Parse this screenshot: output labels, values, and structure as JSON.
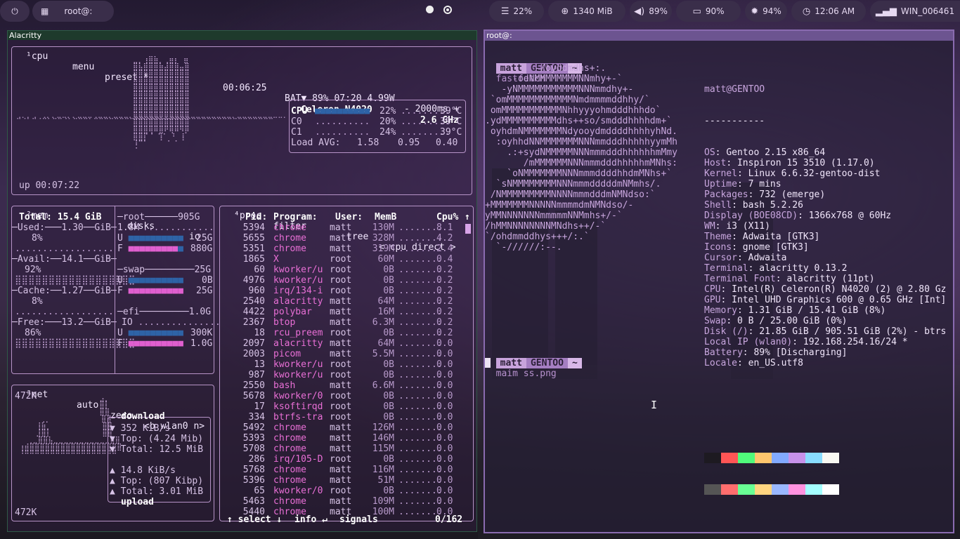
{
  "topbar": {
    "power_icon": "power-icon",
    "apps_icon": "grid-icon",
    "window_title": "root@:",
    "cpu": "22%",
    "ram": "1340 MiB",
    "volume": "89%",
    "battery": "90%",
    "brightness": "94%",
    "time": "12:06 AM",
    "network": "WIN_006461"
  },
  "left_window": {
    "title": "Alacritty",
    "cpu_box": {
      "header_num": "¹cpu",
      "menu": "menu",
      "preset": "preset *",
      "clock": "00:06:25",
      "bat": "BAT▼ 89% 07:20 4.99W",
      "interval": "- 2000ms +",
      "uptime": "up 00:07:22",
      "cpu_name": "Celeron N4020",
      "cpu_freq": "2.6 GHz",
      "rows": [
        {
          "label": "CPU",
          "bar": "■■■■■■■■■■",
          "pct": "22%",
          "temp": "39°C"
        },
        {
          "label": "C0",
          "bar": "..........",
          "pct": "20%",
          "temp": "39°C"
        },
        {
          "label": "C1",
          "bar": "..........",
          "pct": "24%",
          "temp": "39°C"
        }
      ],
      "load_label": "Load AVG:",
      "load": [
        "1.58",
        "0.95",
        "0.40"
      ]
    },
    "mem_box": {
      "header": "²mem",
      "total": "Total: 15.4 GiB",
      "used": "─Used:───1.30──GiB─",
      "used_pct": "8%",
      "avail": "─Avail:──14.1──GiB─",
      "avail_pct": "92%",
      "cache": "─Cache:──1.27──GiB─",
      "cache_pct": "8%",
      "free": "─Free:───13.2──GiB─",
      "free_pct": "86%"
    },
    "disks_box": {
      "header": "disks",
      "io": "io",
      "root_name": "root",
      "root_size": "905G",
      "root_io": "1.8M",
      "root_u": "25G",
      "root_f": "880G",
      "swap_name": "swap",
      "swap_size": "25G",
      "swap_u": "0B",
      "swap_f": "25G",
      "efi_name": "efi",
      "efi_size": "1.0G",
      "efi_io": "IO",
      "efi_u": "300K",
      "efi_f": "1.0G"
    },
    "net_box": {
      "header": "³net",
      "auto": "auto",
      "zero": "zero",
      "iface": "<b wlan0 n>",
      "top_scale": "472K",
      "bottom_scale": "472K",
      "download": "download",
      "dl_rate": "▼ 352 KiB/s",
      "dl_top": "▼ Top: (4.24 Mib)",
      "dl_total": "▼ Total: 12.5 MiB",
      "ul_rate": "▲ 14.8 KiB/s",
      "ul_top": "▲ Top: (807 Kibp)",
      "ul_total": "▲ Total: 3.01 MiB",
      "upload": "upload"
    },
    "proc_box": {
      "header": "⁴proc",
      "filter": "filter",
      "tree": "tree",
      "sort": "< cpu direct >",
      "col_pid": "Pid:",
      "col_prog": "Program:",
      "col_user": "User:",
      "col_mem": "MemB",
      "col_cpu": "Cpu%",
      "footer_select": "↑ select ↓",
      "footer_info": "info ↵",
      "footer_signals": "signals",
      "footer_count": "0/162",
      "rows": [
        {
          "pid": "5394",
          "prog": "chrome",
          "user": "matt",
          "mem": "130M",
          "cpu": "8.1"
        },
        {
          "pid": "5655",
          "prog": "chrome",
          "user": "matt",
          "mem": "328M",
          "cpu": "4.2"
        },
        {
          "pid": "5351",
          "prog": "chrome",
          "user": "matt",
          "mem": "319M",
          "cpu": "2.4"
        },
        {
          "pid": "1865",
          "prog": "X",
          "user": "root",
          "mem": "60M",
          "cpu": "0.4"
        },
        {
          "pid": "60",
          "prog": "kworker/u",
          "user": "root",
          "mem": "0B",
          "cpu": "0.2"
        },
        {
          "pid": "4976",
          "prog": "kworker/u",
          "user": "root",
          "mem": "0B",
          "cpu": "0.2"
        },
        {
          "pid": "960",
          "prog": "irq/134-i",
          "user": "root",
          "mem": "0B",
          "cpu": "0.2"
        },
        {
          "pid": "2540",
          "prog": "alacritty",
          "user": "matt",
          "mem": "64M",
          "cpu": "0.2"
        },
        {
          "pid": "4422",
          "prog": "polybar",
          "user": "matt",
          "mem": "16M",
          "cpu": "0.2"
        },
        {
          "pid": "2367",
          "prog": "btop",
          "user": "matt",
          "mem": "6.3M",
          "cpu": "0.2"
        },
        {
          "pid": "18",
          "prog": "rcu_preem",
          "user": "root",
          "mem": "0B",
          "cpu": "0.2"
        },
        {
          "pid": "2097",
          "prog": "alacritty",
          "user": "matt",
          "mem": "64M",
          "cpu": "0.0"
        },
        {
          "pid": "2003",
          "prog": "picom",
          "user": "matt",
          "mem": "5.5M",
          "cpu": "0.0"
        },
        {
          "pid": "13",
          "prog": "kworker/u",
          "user": "root",
          "mem": "0B",
          "cpu": "0.0"
        },
        {
          "pid": "987",
          "prog": "kworker/u",
          "user": "root",
          "mem": "0B",
          "cpu": "0.0"
        },
        {
          "pid": "2550",
          "prog": "bash",
          "user": "matt",
          "mem": "6.6M",
          "cpu": "0.0"
        },
        {
          "pid": "5678",
          "prog": "kworker/0",
          "user": "root",
          "mem": "0B",
          "cpu": "0.0"
        },
        {
          "pid": "17",
          "prog": "ksoftirqd",
          "user": "root",
          "mem": "0B",
          "cpu": "0.0"
        },
        {
          "pid": "334",
          "prog": "btrfs-tra",
          "user": "root",
          "mem": "0B",
          "cpu": "0.0"
        },
        {
          "pid": "5492",
          "prog": "chrome",
          "user": "matt",
          "mem": "126M",
          "cpu": "0.0"
        },
        {
          "pid": "5393",
          "prog": "chrome",
          "user": "matt",
          "mem": "146M",
          "cpu": "0.0"
        },
        {
          "pid": "5708",
          "prog": "chrome",
          "user": "matt",
          "mem": "115M",
          "cpu": "0.0"
        },
        {
          "pid": "286",
          "prog": "irq/105-D",
          "user": "root",
          "mem": "0B",
          "cpu": "0.0"
        },
        {
          "pid": "5768",
          "prog": "chrome",
          "user": "matt",
          "mem": "116M",
          "cpu": "0.0"
        },
        {
          "pid": "5396",
          "prog": "chrome",
          "user": "matt",
          "mem": "51M",
          "cpu": "0.0"
        },
        {
          "pid": "65",
          "prog": "kworker/0",
          "user": "root",
          "mem": "0B",
          "cpu": "0.0"
        },
        {
          "pid": "5463",
          "prog": "chrome",
          "user": "matt",
          "mem": "109M",
          "cpu": "0.0"
        },
        {
          "pid": "5440",
          "prog": "chrome",
          "user": "matt",
          "mem": "100M",
          "cpu": "0.0"
        }
      ]
    }
  },
  "right_window": {
    "title": "root@:",
    "prompt1": {
      "user": "matt",
      "host": "GENTOO",
      "dir": "~",
      "cmd": "fastfetch"
    },
    "prompt2": {
      "user": "matt",
      "host": "GENTOO",
      "dir": "~",
      "cmd": "maim ss.png"
    },
    "logo_lines": [
      "         -/oyddmdhs+:.",
      "     -odNMMMMMMMMNNmhy+-`",
      "   -yNMMMMMMMMMMMNNNmmdhy+-",
      " `omMMMMMMMMMMMMNmdmmmmddhhy/`",
      " omMMMMMMMMMMMNhhyyyohmdddhhhdo`",
      ".ydMMMMMMMMMMdhs++so/smdddhhhhdm+`",
      " oyhdmNMMMMMMMNdyooydmddddhhhhyhNd.",
      "  :oyhhdNNMMMMMMMNNNmmdddhhhhhyymMh",
      "    .:+sydNMMMMMNNNmmmdddhhhhhhmMmy",
      "       /mMMMMMMNNNmmmdddhhhhhmMNhs:",
      "    `oNMMMMMMMNNNmmmddddhhdmMNhs+`",
      "  `sNMMMMMMMMNNNmmmdddddmNMmhs/.",
      " /NMMMMMMMMMNNNNmmmdddmNMNdso:`",
      "+MMMMMMMNNNNNmmmmdmNMNdso/-",
      "yMMNNNNNNNmmmmmNNMmhs+/-`",
      "/hMMNNNNNNNNMNdhs++/-`",
      "`/ohdmmddhys+++/:.`",
      "  `-//////:--."
    ],
    "info": {
      "user_host": "matt@GENTOO",
      "sep": "-----------",
      "rows": [
        {
          "k": "OS",
          "v": "Gentoo 2.15 x86_64"
        },
        {
          "k": "Host",
          "v": "Inspiron 15 3510 (1.17.0)"
        },
        {
          "k": "Kernel",
          "v": "Linux 6.6.32-gentoo-dist"
        },
        {
          "k": "Uptime",
          "v": "7 mins"
        },
        {
          "k": "Packages",
          "v": "732 (emerge)"
        },
        {
          "k": "Shell",
          "v": "bash 5.2.26"
        },
        {
          "k": "Display (BOE08CD)",
          "v": "1366x768 @ 60Hz"
        },
        {
          "k": "WM",
          "v": "i3 (X11)"
        },
        {
          "k": "Theme",
          "v": "Adwaita [GTK3]"
        },
        {
          "k": "Icons",
          "v": "gnome [GTK3]"
        },
        {
          "k": "Cursor",
          "v": "Adwaita"
        },
        {
          "k": "Terminal",
          "v": "alacritty 0.13.2"
        },
        {
          "k": "Terminal Font",
          "v": "alacritty (11pt)"
        },
        {
          "k": "CPU",
          "v": "Intel(R) Celeron(R) N4020 (2) @ 2.80 Gz"
        },
        {
          "k": "GPU",
          "v": "Intel UHD Graphics 600 @ 0.65 GHz [Int]"
        },
        {
          "k": "Memory",
          "v": "1.31 GiB / 15.41 GiB (8%)"
        },
        {
          "k": "Swap",
          "v": "0 B / 25.00 GiB (0%)"
        },
        {
          "k": "Disk (/)",
          "v": "21.85 GiB / 905.51 GiB (2%) - btrs"
        },
        {
          "k": "Local IP (wlan0)",
          "v": "192.168.254.16/24 *"
        },
        {
          "k": "Battery",
          "v": "89% [Discharging]"
        },
        {
          "k": "Locale",
          "v": "en_US.utf8"
        }
      ]
    },
    "palette_top": [
      "#1d1a21",
      "#ff5555",
      "#50fa7b",
      "#ffc66d",
      "#82aaff",
      "#c792ea",
      "#89ddff",
      "#f8f8f2"
    ],
    "palette_bottom": [
      "#555555",
      "#ff6e6e",
      "#69ff94",
      "#ffd580",
      "#9ab8ff",
      "#ff92df",
      "#a4ffff",
      "#ffffff"
    ]
  }
}
